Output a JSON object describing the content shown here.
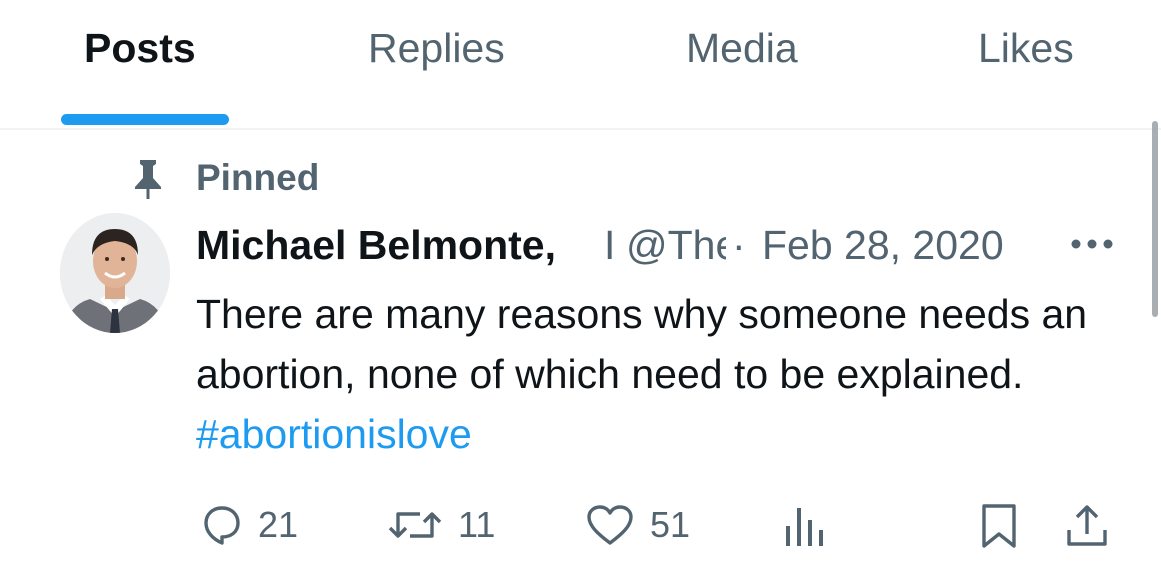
{
  "tabs": [
    {
      "label": "Posts",
      "active": true
    },
    {
      "label": "Replies",
      "active": false
    },
    {
      "label": "Media",
      "active": false
    },
    {
      "label": "Likes",
      "active": false
    }
  ],
  "post": {
    "pinned_label": "Pinned",
    "author_name": "Michael Belmonte,",
    "author_name_truncated": "I",
    "handle": "@The",
    "separator": "·",
    "date": "Feb 28, 2020",
    "text": "There are many reasons why someone needs an abortion, none of which need to be explained.",
    "hashtag": "#abortionislove",
    "actions": {
      "replies": "21",
      "reposts": "11",
      "likes": "51"
    }
  },
  "icons": {
    "pin": "pin-icon",
    "more": "more-horizontal-icon",
    "reply": "reply-icon",
    "repost": "repost-icon",
    "like": "heart-icon",
    "views": "analytics-icon",
    "bookmark": "bookmark-icon",
    "share": "share-icon"
  },
  "colors": {
    "accent": "#1d9bf0",
    "text_primary": "#0f1419",
    "text_secondary": "#536471"
  }
}
